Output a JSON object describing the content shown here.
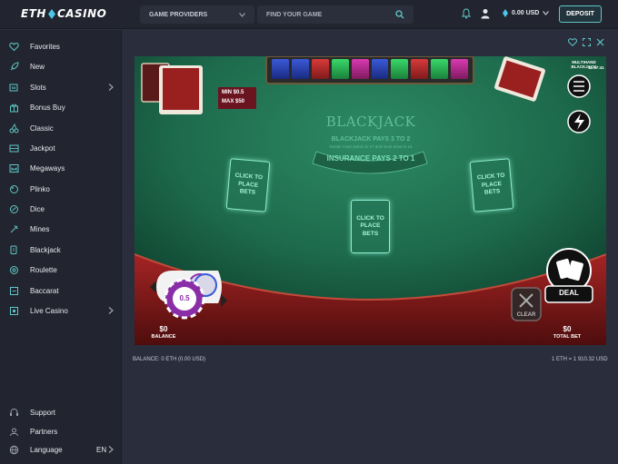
{
  "header": {
    "logo_left": "ETH",
    "logo_right": "CASINO",
    "providers_label": "GAME PROVIDERS",
    "search_placeholder": "FIND YOUR GAME",
    "balance": "0.00 USD",
    "deposit_label": "DEPOSIT"
  },
  "sidebar": {
    "items": [
      {
        "label": "Favorites",
        "icon": "heart-icon"
      },
      {
        "label": "New",
        "icon": "rocket-icon"
      },
      {
        "label": "Slots",
        "icon": "slot-machine-icon"
      },
      {
        "label": "Bonus Buy",
        "icon": "gift-icon"
      },
      {
        "label": "Classic",
        "icon": "cherry-icon"
      },
      {
        "label": "Jackpot",
        "icon": "jackpot-icon"
      },
      {
        "label": "Megaways",
        "icon": "megaways-icon"
      },
      {
        "label": "Plinko",
        "icon": "plinko-icon"
      },
      {
        "label": "Dice",
        "icon": "dice-icon"
      },
      {
        "label": "Mines",
        "icon": "mines-icon"
      },
      {
        "label": "Blackjack",
        "icon": "cards-icon"
      },
      {
        "label": "Roulette",
        "icon": "roulette-icon"
      },
      {
        "label": "Baccarat",
        "icon": "baccarat-icon"
      },
      {
        "label": "Live Casino",
        "icon": "live-icon"
      }
    ],
    "bottom": [
      {
        "label": "Support",
        "icon": "headset-icon"
      },
      {
        "label": "Partners",
        "icon": "partners-icon"
      },
      {
        "label": "Language",
        "icon": "globe-icon",
        "value": "EN"
      }
    ]
  },
  "game": {
    "corner_title": "MULTIHAND BLACKJACK",
    "clock": "11:57:41",
    "min_bet": "MIN $0.5",
    "max_bet": "MAX $50",
    "table_title": "BLACKJACK",
    "table_rule1": "BLACKJACK PAYS 3 TO 2",
    "table_rule2": "Dealer must stand on 17 and must draw to 16",
    "table_rule3": "INSURANCE PAYS 2 TO 1",
    "spot_label": "CLICK TO PLACE BETS",
    "chip_value": "0.5",
    "balance_value": "$0",
    "balance_label": "BALANCE",
    "total_bet_value": "$0",
    "total_bet_label": "TOTAL BET",
    "deal_label": "DEAL",
    "clear_label": "CLEAR"
  },
  "footer": {
    "balance_text": "BALANCE: 0 ETH (0.00 USD)",
    "rate_text": "1 ETH = 1 910.32 USD"
  },
  "colors": {
    "accent": "#5fc8c8",
    "felt": "#1d6a4c",
    "rail": "#7a1616",
    "chip": "#8a2ea8"
  }
}
